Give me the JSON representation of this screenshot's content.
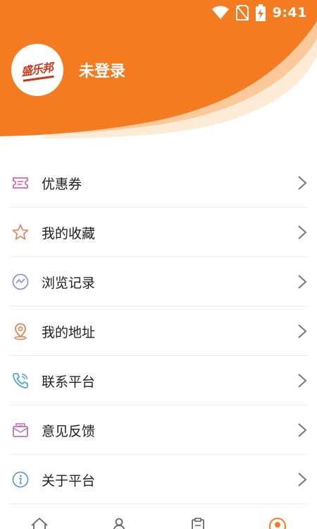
{
  "theme": {
    "accent": "#F47B20",
    "accent_light": "#FBC99A",
    "cream": "#FDEBD6",
    "text": "#1F1F1F"
  },
  "status_bar": {
    "time": "9:41",
    "icons": [
      "wifi-icon",
      "no-sim-icon",
      "battery-charging-icon"
    ]
  },
  "profile": {
    "username": "未登录",
    "logo_text": "盛乐邦"
  },
  "menu": {
    "items": [
      {
        "label": "优惠券",
        "icon": "coupon-icon",
        "icon_color": "#E0639C"
      },
      {
        "label": "我的收藏",
        "icon": "star-icon",
        "icon_color": "#E48A6C"
      },
      {
        "label": "浏览记录",
        "icon": "history-icon",
        "icon_color": "#8D95D8"
      },
      {
        "label": "我的地址",
        "icon": "location-pin-icon",
        "icon_color": "#D98655"
      },
      {
        "label": "联系平台",
        "icon": "phone-icon",
        "icon_color": "#4FA9C9"
      },
      {
        "label": "意见反馈",
        "icon": "feedback-mail-icon",
        "icon_color": "#C06FBF"
      },
      {
        "label": "关于平台",
        "icon": "info-icon",
        "icon_color": "#6C9BD2"
      }
    ]
  },
  "tabbar": {
    "tabs": [
      "home-tab-icon",
      "category-tab-icon",
      "orders-tab-icon",
      "profile-tab-icon"
    ],
    "active_tab": "profile-tab-icon"
  }
}
